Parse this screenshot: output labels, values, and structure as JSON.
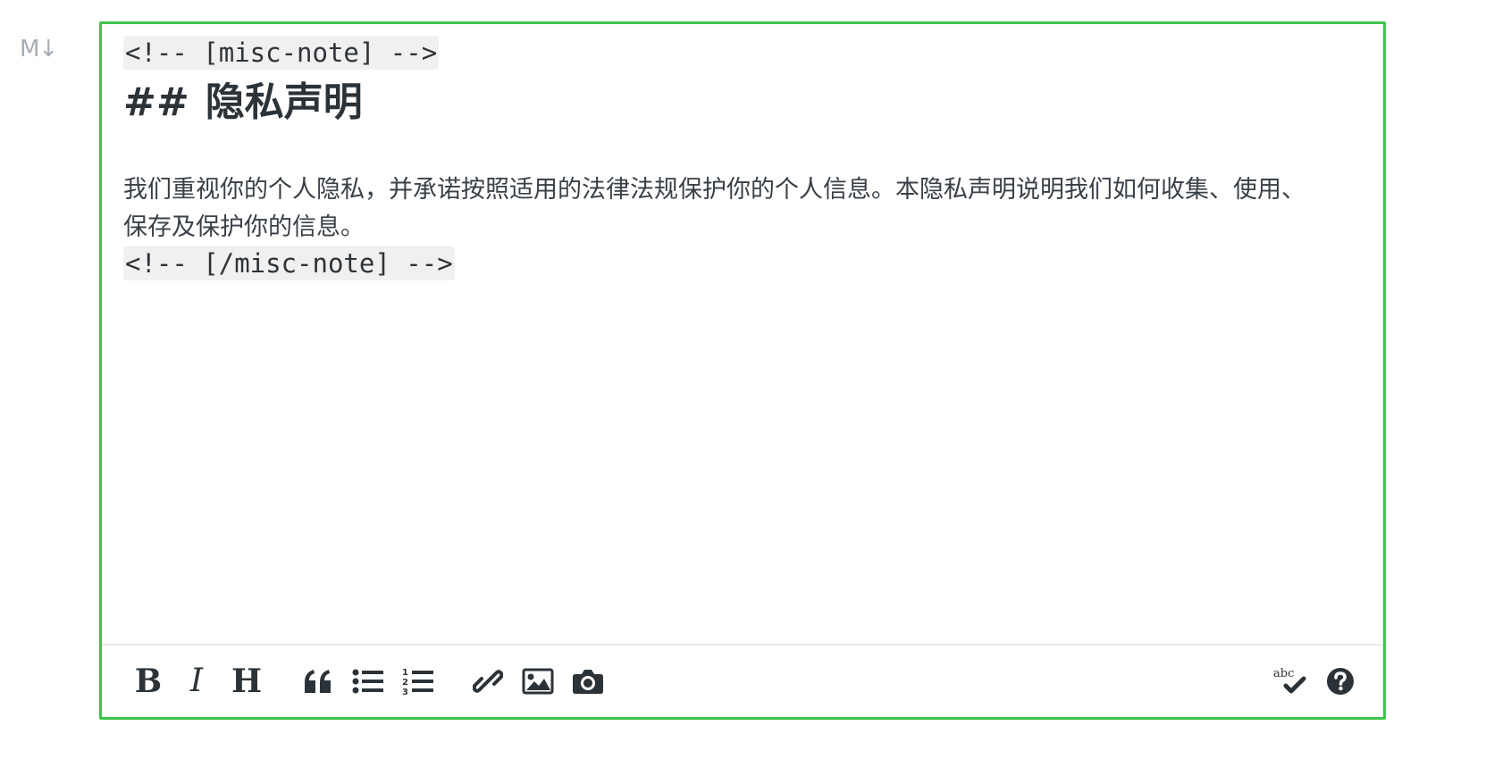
{
  "badge": {
    "label": "M↓"
  },
  "editor": {
    "accent_color": "#3ec44d",
    "lines": {
      "open_comment": "<!-- [misc-note] -->",
      "heading_hash": "##",
      "heading_text": "隐私声明",
      "paragraph": "我们重视你的个人隐私，并承诺按照适用的法律法规保护你的个人信息。本隐私声明说明我们如何收集、使用、保存及保护你的信息。",
      "close_comment": "<!-- [/misc-note] -->"
    }
  },
  "toolbar": {
    "bold_label": "B",
    "italic_label": "I",
    "heading_label": "H",
    "spellcheck_label": "abc",
    "icons": [
      "bold-icon",
      "italic-icon",
      "heading-icon",
      "quote-icon",
      "bullet-list-icon",
      "numbered-list-icon",
      "link-icon",
      "image-icon",
      "camera-icon",
      "spellcheck-icon",
      "help-icon"
    ]
  }
}
